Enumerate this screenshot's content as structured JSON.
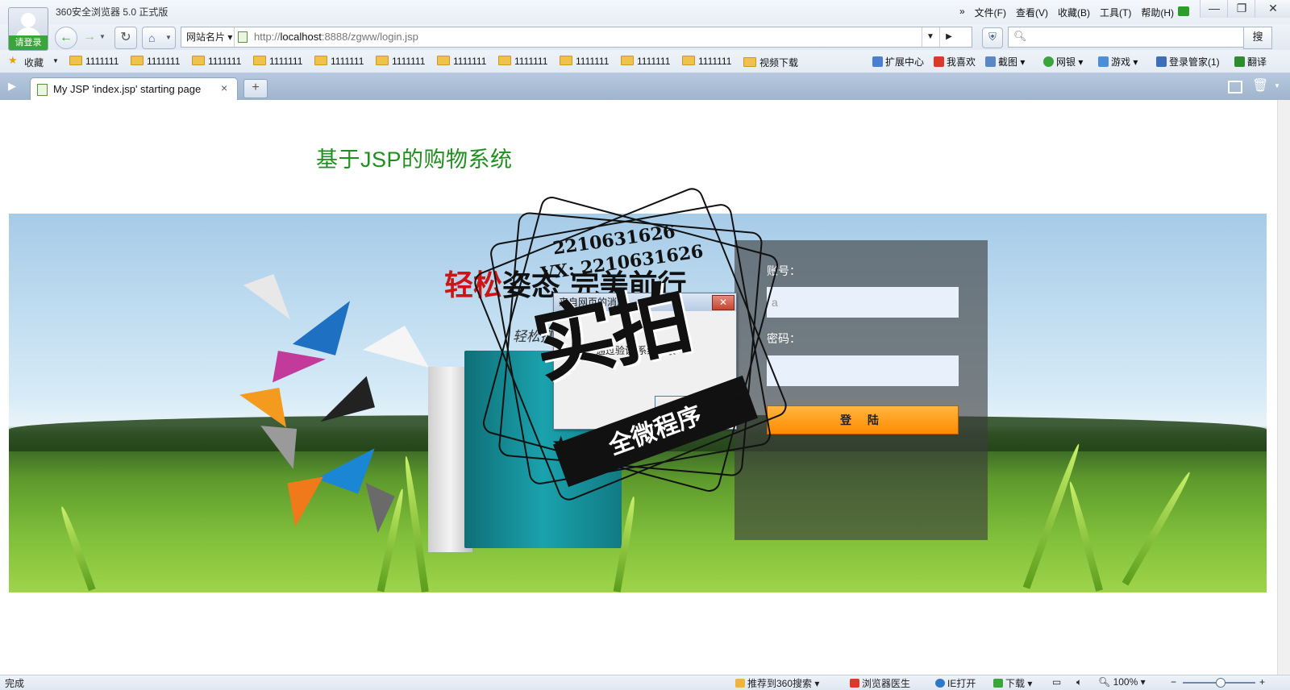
{
  "browser": {
    "title": "360安全浏览器 5.0 正式版",
    "login_label": "请登录",
    "menu": [
      "文件(F)",
      "查看(V)",
      "收藏(B)",
      "工具(T)",
      "帮助(H)"
    ],
    "site_card": "网站名片",
    "url_prefix": "http://",
    "url_host": "localhost",
    "url_rest": ":8888/zgww/login.jsp",
    "search_button": "搜",
    "search_placeholder": "Q",
    "favorites_label": "收藏",
    "bookmarks": [
      "1111111",
      "1111111",
      "1111111",
      "1111111",
      "1111111",
      "1111111",
      "1111111",
      "1111111",
      "1111111",
      "1111111",
      "1111111",
      "视频下载"
    ],
    "tools": [
      "扩展中心",
      "我喜欢",
      "截图",
      "网银",
      "游戏",
      "登录管家(1)",
      "翻译"
    ],
    "tab_title": "My JSP 'index.jsp' starting page",
    "tab_close": "×",
    "new_tab": "+"
  },
  "page": {
    "heading": "基于JSP的购物系统",
    "slogan_red": "轻松",
    "slogan_rest": "姿态  完美前行",
    "slogan_sub": "轻松携手",
    "username_label": "账号：",
    "password_label": "密码：",
    "username_value": "a",
    "password_value": "",
    "login_button": "登 陆"
  },
  "dialog": {
    "title": "来自网页的消息",
    "message": "通过验证,系统登录",
    "close": "✕",
    "ok_button": ""
  },
  "watermark": {
    "phone": "2210631626",
    "wx": "VX: 2210631626",
    "big": "实拍",
    "ribbon": "全微程序"
  },
  "status": {
    "text": "完成",
    "items": [
      "推荐到360搜索",
      "浏览器医生",
      "IE打开",
      "下载"
    ],
    "zoom": "100%"
  },
  "colors": {
    "heading": "#1f8f1f",
    "login_button": "#ff8b00",
    "slogan_red": "#cc1515"
  }
}
